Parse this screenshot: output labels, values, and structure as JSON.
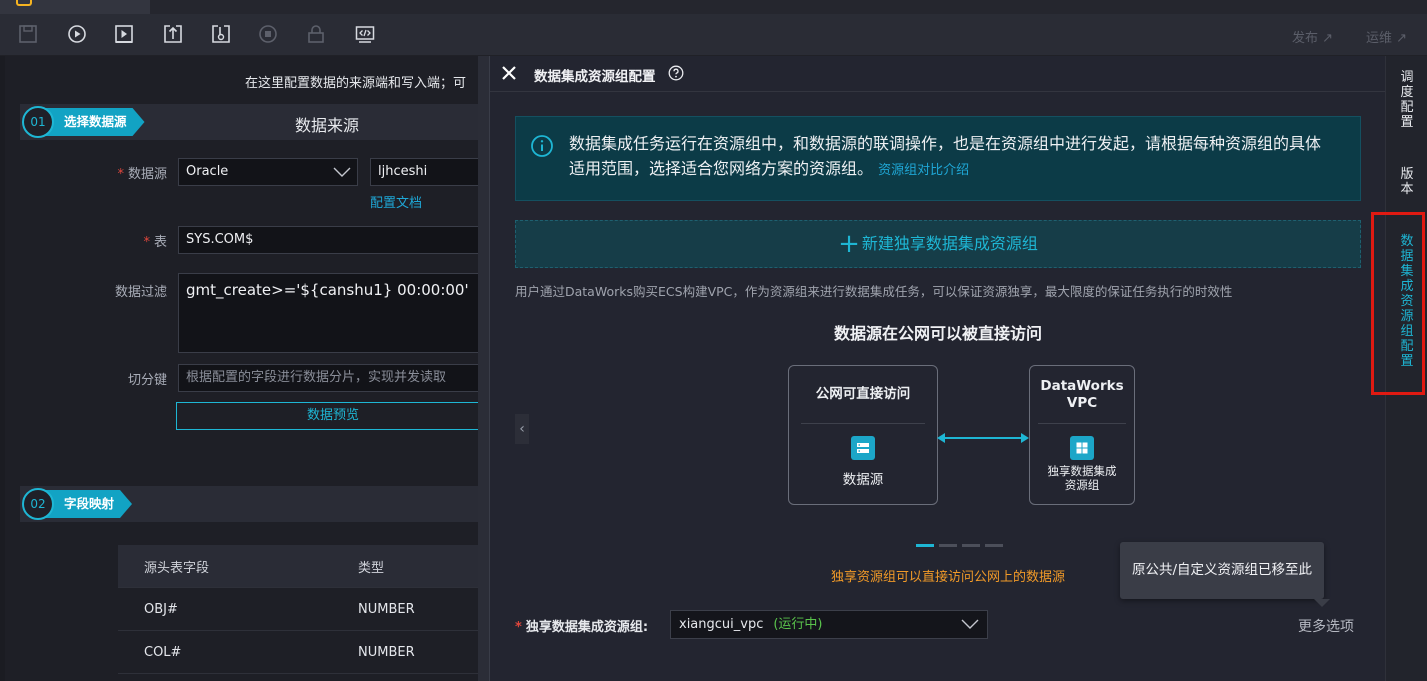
{
  "toolbar": {
    "icons": [
      "save-icon",
      "run-icon",
      "run-params-icon",
      "submit-icon",
      "deploy-icon",
      "stop-icon",
      "lock-icon",
      "code-icon"
    ],
    "publish_label": "发布 ↗",
    "ops_label": "运维 ↗"
  },
  "left": {
    "hint": "在这里配置数据的来源端和写入端；可",
    "step1": {
      "num": "01",
      "label": "选择数据源",
      "title": "数据来源"
    },
    "datasource": {
      "label": "数据源",
      "type": "Oracle",
      "name": "ljhceshi",
      "doc_link": "配置文档"
    },
    "table": {
      "label": "表",
      "value": "SYS.COM$"
    },
    "filter": {
      "label": "数据过滤",
      "value": "gmt_create>='${canshu1} 00:00:00'"
    },
    "split": {
      "label": "切分键",
      "placeholder": "根据配置的字段进行数据分片，实现并发读取"
    },
    "preview_button": "数据预览",
    "step2": {
      "num": "02",
      "label": "字段映射"
    },
    "mapping": {
      "headers": [
        "源头表字段",
        "类型"
      ],
      "rows": [
        [
          "OBJ#",
          "NUMBER"
        ],
        [
          "COL#",
          "NUMBER"
        ]
      ]
    }
  },
  "drawer": {
    "title": "数据集成资源组配置",
    "info_text": "数据集成任务运行在资源组中，和数据源的联调操作，也是在资源组中进行发起，请根据每种资源组的具体适用范围，选择适合您网络方案的资源组。",
    "info_link": "资源组对比介绍",
    "create_label": "新建独享数据集成资源组",
    "create_desc": "用户通过DataWorks购买ECS构建VPC，作为资源组来进行数据集成任务，可以保证资源独享，最大限度的保证任务执行的时效性",
    "carousel": {
      "title": "数据源在公网可以被直接访问",
      "left_card": {
        "top": "公网可直接访问",
        "label": "数据源"
      },
      "right_card": {
        "top_line1": "DataWorks",
        "top_line2": "VPC",
        "label_line1": "独享数据集成",
        "label_line2": "资源组"
      },
      "note": "独享资源组可以直接访问公网上的数据源",
      "slides": 4,
      "active_slide": 1
    },
    "tooltip": "原公共/自定义资源组已移至此",
    "resource_group": {
      "label": "独享数据集成资源组:",
      "value": "xiangcui_vpc",
      "status": "(运行中)"
    },
    "more_options": "更多选项"
  },
  "rail": {
    "items": [
      {
        "label": "调度配置",
        "chars": [
          "调",
          "度",
          "配",
          "置"
        ]
      },
      {
        "label": "版本",
        "chars": [
          "版",
          "本"
        ]
      },
      {
        "label": "数据集成资源组配置",
        "chars": [
          "数",
          "据",
          "集",
          "成",
          "资",
          "源",
          "组",
          "配",
          "置"
        ]
      }
    ]
  },
  "colors": {
    "accent": "#1eb6d4",
    "highlight": "#e01a12",
    "running": "#5ac44c",
    "note": "#f19a28"
  }
}
